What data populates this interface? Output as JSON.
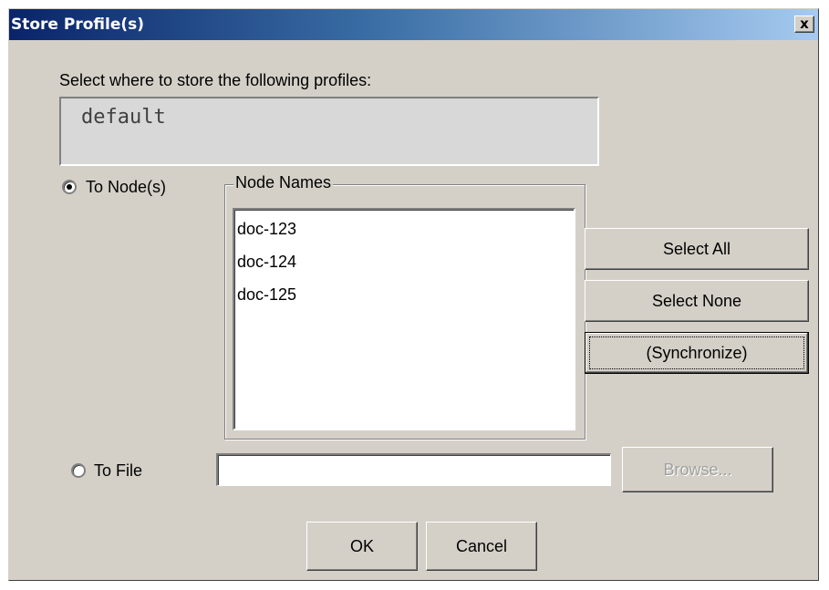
{
  "window": {
    "title": "Store Profile(s)",
    "close_glyph": "x"
  },
  "prompt": {
    "label": "Select where to store the following profiles:",
    "profiles_text": "default"
  },
  "to_node": {
    "label": "To Node(s)",
    "selected": true,
    "group_label": "Node Names",
    "nodes": [
      "doc-123",
      "doc-124",
      "doc-125"
    ]
  },
  "buttons": {
    "select_all": "Select All",
    "select_none": "Select None",
    "synchronize": "(Synchronize)",
    "browse": "Browse...",
    "ok": "OK",
    "cancel": "Cancel"
  },
  "to_file": {
    "label": "To File",
    "selected": false,
    "value": ""
  }
}
